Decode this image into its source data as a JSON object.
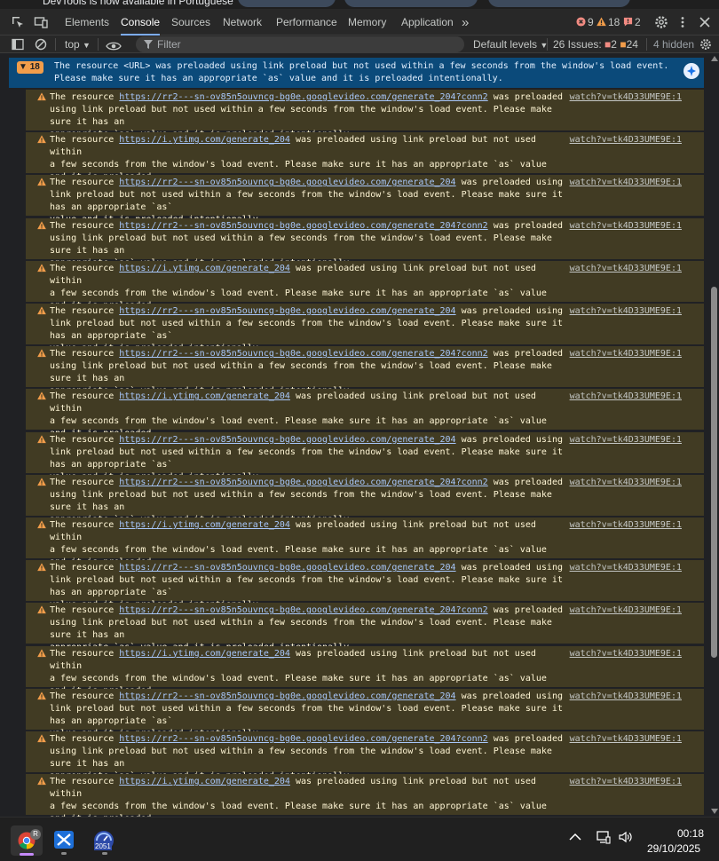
{
  "window": {
    "tab_title_fragment": "DevTools is now available in Portuguese"
  },
  "devtools": {
    "tabs": [
      {
        "label": "Elements"
      },
      {
        "label": "Console",
        "selected": true
      },
      {
        "label": "Sources"
      },
      {
        "label": "Network"
      },
      {
        "label": "Performance"
      },
      {
        "label": "Memory"
      },
      {
        "label": "Application"
      }
    ],
    "more_tabs": "»",
    "counts": {
      "errors": "9",
      "warnings": "18",
      "issues": "2"
    },
    "toolbar": {
      "context": "top",
      "filter_placeholder": "Filter",
      "levels": "Default levels",
      "issues_label": "26 Issues:",
      "issues_error": "2",
      "issues_warn": "24",
      "hidden": "4 hidden"
    }
  },
  "console": {
    "group": {
      "count": "18",
      "text": "The resource <URL> was preloaded using link preload but not used within a few seconds from the window's load event.\nPlease make sure it has an appropriate `as` value and it is preloaded intentionally."
    },
    "source_link": "watch?v=tk4D33UME9E:1",
    "messages": [
      {
        "pre": "The resource ",
        "url": "https://rr2---sn-ov85n5ouvncg-bg0e.googlevideo.com/generate_204?conn2",
        "post": " was preloaded \nusing link preload but not used within a few seconds from the window's load event. Please make sure it has an\nappropriate `as` value and it is preloaded intentionally."
      },
      {
        "pre": "The resource ",
        "url": "https://i.ytimg.com/generate_204",
        "post": " was preloaded using link preload but not used within\na few seconds from the window's load event. Please make sure it has an appropriate `as` value and it is preloaded\nintentionally."
      },
      {
        "pre": "The resource ",
        "url": "https://rr2---sn-ov85n5ouvncg-bg0e.googlevideo.com/generate_204",
        "post": " was preloaded using \nlink preload but not used within a few seconds from the window's load event. Please make sure it has an appropriate `as`\nvalue and it is preloaded intentionally."
      },
      {
        "pre": "The resource ",
        "url": "https://rr2---sn-ov85n5ouvncg-bg0e.googlevideo.com/generate_204?conn2",
        "post": " was preloaded \nusing link preload but not used within a few seconds from the window's load event. Please make sure it has an\nappropriate `as` value and it is preloaded intentionally."
      },
      {
        "pre": "The resource ",
        "url": "https://i.ytimg.com/generate_204",
        "post": " was preloaded using link preload but not used within\na few seconds from the window's load event. Please make sure it has an appropriate `as` value and it is preloaded\nintentionally."
      },
      {
        "pre": "The resource ",
        "url": "https://rr2---sn-ov85n5ouvncg-bg0e.googlevideo.com/generate_204",
        "post": " was preloaded using \nlink preload but not used within a few seconds from the window's load event. Please make sure it has an appropriate `as`\nvalue and it is preloaded intentionally."
      },
      {
        "pre": "The resource ",
        "url": "https://rr2---sn-ov85n5ouvncg-bg0e.googlevideo.com/generate_204?conn2",
        "post": " was preloaded \nusing link preload but not used within a few seconds from the window's load event. Please make sure it has an\nappropriate `as` value and it is preloaded intentionally."
      },
      {
        "pre": "The resource ",
        "url": "https://i.ytimg.com/generate_204",
        "post": " was preloaded using link preload but not used within\na few seconds from the window's load event. Please make sure it has an appropriate `as` value and it is preloaded\nintentionally."
      },
      {
        "pre": "The resource ",
        "url": "https://rr2---sn-ov85n5ouvncg-bg0e.googlevideo.com/generate_204",
        "post": " was preloaded using \nlink preload but not used within a few seconds from the window's load event. Please make sure it has an appropriate `as`\nvalue and it is preloaded intentionally."
      },
      {
        "pre": "The resource ",
        "url": "https://rr2---sn-ov85n5ouvncg-bg0e.googlevideo.com/generate_204?conn2",
        "post": " was preloaded \nusing link preload but not used within a few seconds from the window's load event. Please make sure it has an\nappropriate `as` value and it is preloaded intentionally."
      },
      {
        "pre": "The resource ",
        "url": "https://i.ytimg.com/generate_204",
        "post": " was preloaded using link preload but not used within\na few seconds from the window's load event. Please make sure it has an appropriate `as` value and it is preloaded\nintentionally."
      },
      {
        "pre": "The resource ",
        "url": "https://rr2---sn-ov85n5ouvncg-bg0e.googlevideo.com/generate_204",
        "post": " was preloaded using \nlink preload but not used within a few seconds from the window's load event. Please make sure it has an appropriate `as`\nvalue and it is preloaded intentionally."
      },
      {
        "pre": "The resource ",
        "url": "https://rr2---sn-ov85n5ouvncg-bg0e.googlevideo.com/generate_204?conn2",
        "post": " was preloaded \nusing link preload but not used within a few seconds from the window's load event. Please make sure it has an\nappropriate `as` value and it is preloaded intentionally."
      },
      {
        "pre": "The resource ",
        "url": "https://i.ytimg.com/generate_204",
        "post": " was preloaded using link preload but not used within\na few seconds from the window's load event. Please make sure it has an appropriate `as` value and it is preloaded\nintentionally."
      },
      {
        "pre": "The resource ",
        "url": "https://rr2---sn-ov85n5ouvncg-bg0e.googlevideo.com/generate_204",
        "post": " was preloaded using \nlink preload but not used within a few seconds from the window's load event. Please make sure it has an appropriate `as`\nvalue and it is preloaded intentionally."
      },
      {
        "pre": "The resource ",
        "url": "https://rr2---sn-ov85n5ouvncg-bg0e.googlevideo.com/generate_204?conn2",
        "post": " was preloaded \nusing link preload but not used within a few seconds from the window's load event. Please make sure it has an\nappropriate `as` value and it is preloaded intentionally."
      },
      {
        "pre": "The resource ",
        "url": "https://i.ytimg.com/generate_204",
        "post": " was preloaded using link preload but not used within\na few seconds from the window's load event. Please make sure it has an appropriate `as` value and it is preloaded\nintentionally."
      }
    ]
  },
  "taskbar": {
    "chrome_badge": "R",
    "app3_badge": "2051",
    "time": "00:18",
    "date": "29/10/2025"
  },
  "colors": {
    "accent": "#7cacf8",
    "warning_bg": "#413b23",
    "group_bg": "#0b4a7a",
    "error": "#f28b82",
    "warning": "#f29d4a"
  }
}
